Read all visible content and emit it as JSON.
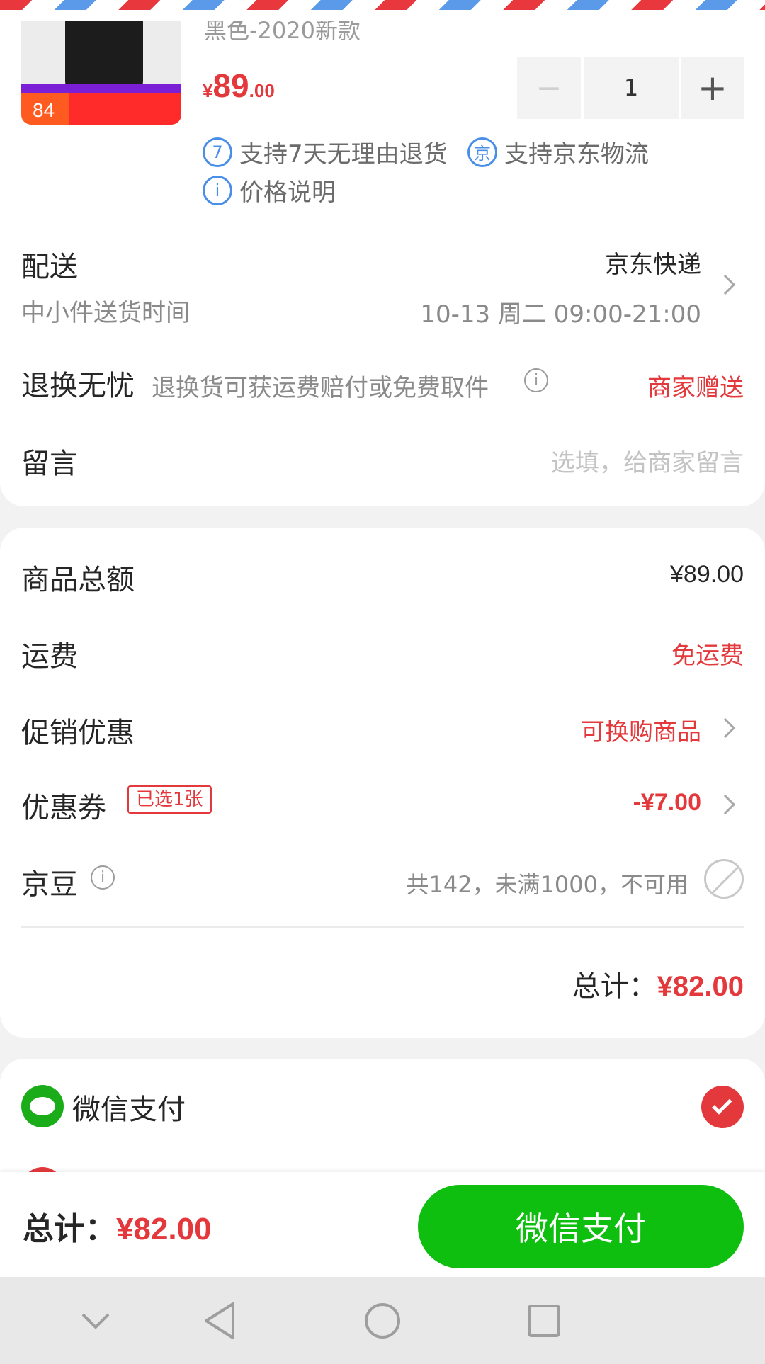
{
  "product": {
    "sku": "黑色-2020新款",
    "thumb_badge": "84",
    "price_symbol": "¥",
    "price_int": "89",
    "price_dec": ".00",
    "quantity": "1",
    "minus_symbol": "−",
    "plus_symbol": "+",
    "services": [
      {
        "badge": "7",
        "label": "支持7天无理由退货"
      },
      {
        "badge": "京",
        "label": "支持京东物流"
      },
      {
        "badge": "i",
        "label": "价格说明"
      }
    ]
  },
  "delivery": {
    "label": "配送",
    "method": "京东快递",
    "time_label": "中小件送货时间",
    "time_value": "10-13 周二 09:00-21:00"
  },
  "return": {
    "label": "退换无忧",
    "desc": "退换货可获运费赔付或免费取件",
    "value": "商家赠送"
  },
  "message": {
    "label": "留言",
    "placeholder": "选填，给商家留言"
  },
  "summary": {
    "goods_total_label": "商品总额",
    "goods_total_value": "¥89.00",
    "shipping_label": "运费",
    "shipping_value": "免运费",
    "promo_label": "促销优惠",
    "promo_value": "可换购商品",
    "coupon_label": "优惠券",
    "coupon_tag": "已选1张",
    "coupon_value": "-¥7.00",
    "jingdou_label": "京豆",
    "jingdou_value": "共142，未满1000，不可用",
    "total_label": "总计：",
    "total_value": "¥82.00"
  },
  "payment": {
    "method": "微信支付"
  },
  "bottom": {
    "total_label": "总计：",
    "total_value": "¥82.00",
    "pay_button": "微信支付"
  },
  "colors": {
    "accent_red": "#e4393c",
    "wechat_green": "#0fbf10",
    "service_blue": "#4a8fe7"
  },
  "icons": [
    "back-chevron-icon",
    "nav-back-icon",
    "nav-home-icon",
    "nav-recents-icon",
    "info-icon",
    "chevron-right-icon",
    "wechat-icon",
    "check-icon",
    "disabled-icon"
  ]
}
